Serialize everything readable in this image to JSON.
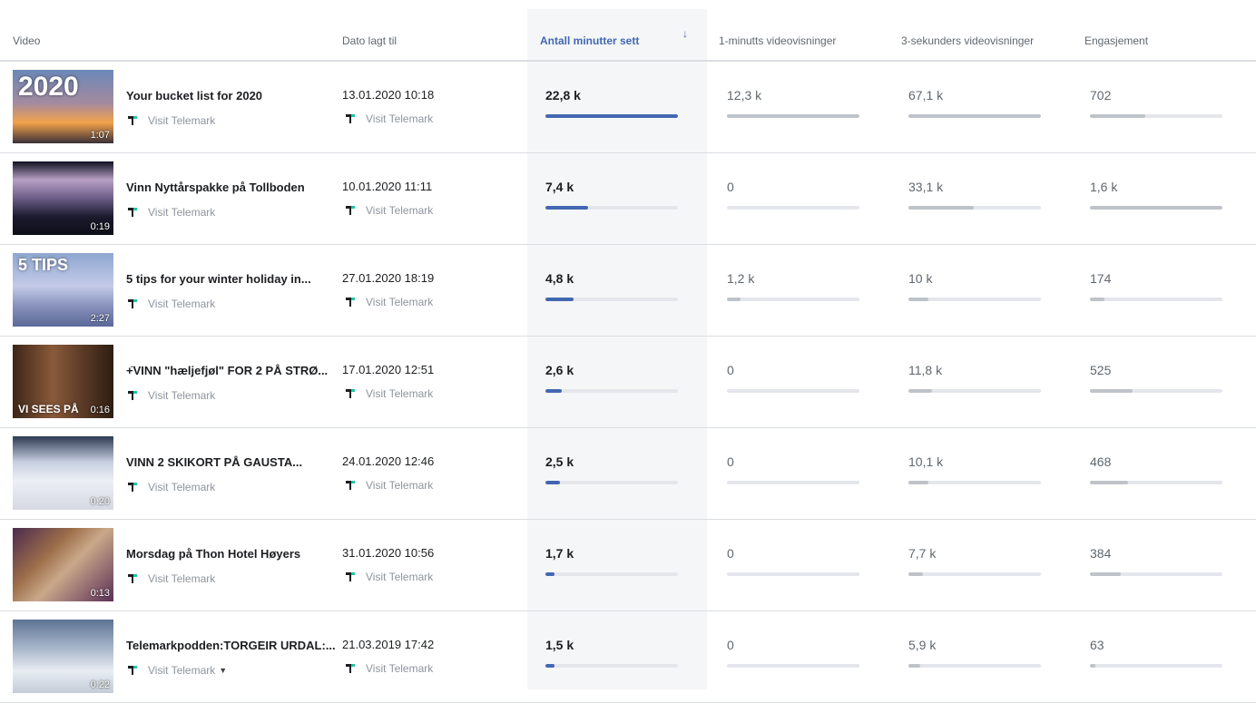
{
  "headers": {
    "video": "Video",
    "date": "Dato lagt til",
    "minutes": "Antall minutter sett",
    "one_min": "1-minutts videovisninger",
    "three_sec": "3-sekunders videovisninger",
    "engagement": "Engasjement",
    "sort_icon": "arrow-down-icon"
  },
  "colors": {
    "accent": "#4267b2",
    "bar_grey": "#bec3c9",
    "track": "#e4e6eb",
    "logo_green": "#1ec6a0"
  },
  "rows": [
    {
      "title": "Your bucket list for 2020",
      "page": "Visit Telemark",
      "date": "13.01.2020 10:18",
      "date_page": "Visit Telemark",
      "duration": "1:07",
      "thumb_text": "2020",
      "minutes": "22,8 k",
      "minutes_fill": 1.0,
      "one_min": "12,3 k",
      "one_min_fill": 1.0,
      "three_sec": "67,1 k",
      "three_sec_fill": 1.0,
      "engagement": "702",
      "engagement_fill": 0.42
    },
    {
      "title": "Vinn Nyttårspakke på Tollboden",
      "page": "Visit Telemark",
      "date": "10.01.2020 11:11",
      "date_page": "Visit Telemark",
      "duration": "0:19",
      "thumb_text": "",
      "minutes": "7,4 k",
      "minutes_fill": 0.32,
      "one_min": "0",
      "one_min_fill": 0,
      "three_sec": "33,1 k",
      "three_sec_fill": 0.49,
      "engagement": "1,6 k",
      "engagement_fill": 1.0
    },
    {
      "title": "5 tips for your winter holiday in...",
      "page": "Visit Telemark",
      "date": "27.01.2020 18:19",
      "date_page": "Visit Telemark",
      "duration": "2:27",
      "thumb_text": "5 TIPS",
      "minutes": "4,8 k",
      "minutes_fill": 0.21,
      "one_min": "1,2 k",
      "one_min_fill": 0.1,
      "three_sec": "10 k",
      "three_sec_fill": 0.15,
      "engagement": "174",
      "engagement_fill": 0.11
    },
    {
      "title": "+̈VINN \"hæljefjøl\" FOR 2 PÅ STRØ...",
      "page": "Visit Telemark",
      "date": "17.01.2020 12:51",
      "date_page": "Visit Telemark",
      "duration": "0:16",
      "thumb_text": "VI SEES PÅ",
      "minutes": "2,6 k",
      "minutes_fill": 0.12,
      "one_min": "0",
      "one_min_fill": 0,
      "three_sec": "11,8 k",
      "three_sec_fill": 0.18,
      "engagement": "525",
      "engagement_fill": 0.32
    },
    {
      "title": "VINN 2 SKIKORT PÅ GAUSTA...",
      "page": "Visit Telemark",
      "date": "24.01.2020 12:46",
      "date_page": "Visit Telemark",
      "duration": "0:20",
      "thumb_text": "",
      "minutes": "2,5 k",
      "minutes_fill": 0.11,
      "one_min": "0",
      "one_min_fill": 0,
      "three_sec": "10,1 k",
      "three_sec_fill": 0.15,
      "engagement": "468",
      "engagement_fill": 0.29
    },
    {
      "title": "Morsdag på Thon Hotel Høyers",
      "page": "Visit Telemark",
      "date": "31.01.2020 10:56",
      "date_page": "Visit Telemark",
      "duration": "0:13",
      "thumb_text": "",
      "minutes": "1,7 k",
      "minutes_fill": 0.07,
      "one_min": "0",
      "one_min_fill": 0,
      "three_sec": "7,7 k",
      "three_sec_fill": 0.11,
      "engagement": "384",
      "engagement_fill": 0.23
    },
    {
      "title": "Telemarkpodden:TORGEIR URDAL:...",
      "page": "Visit Telemark",
      "date": "21.03.2019 17:42",
      "date_page": "Visit Telemark",
      "duration": "0:22",
      "thumb_text": "",
      "minutes": "1,5 k",
      "minutes_fill": 0.07,
      "one_min": "0",
      "one_min_fill": 0,
      "three_sec": "5,9 k",
      "three_sec_fill": 0.09,
      "engagement": "63",
      "engagement_fill": 0.04,
      "has_caret": true
    }
  ]
}
